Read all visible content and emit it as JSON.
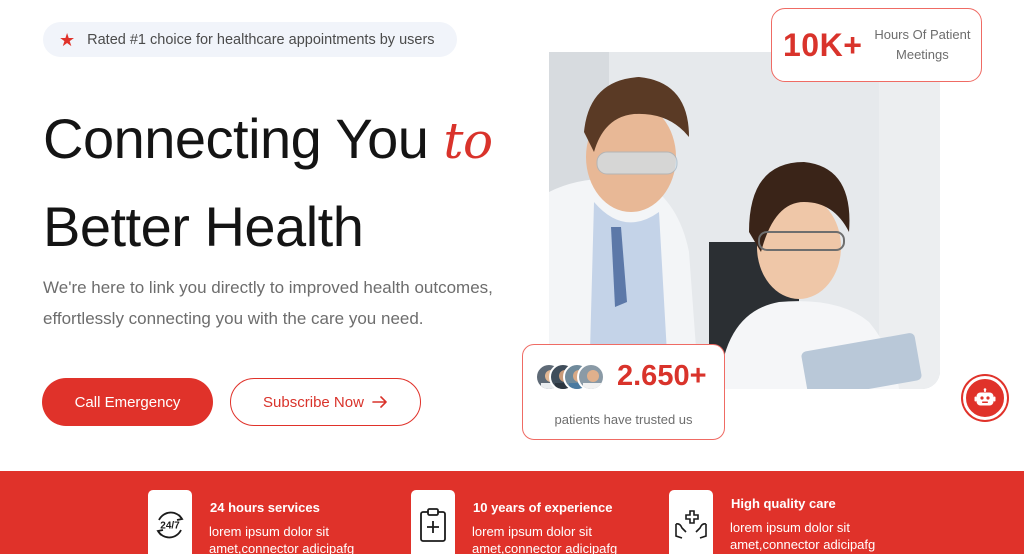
{
  "badge": {
    "text": "Rated #1 choice for healthcare appointments by users",
    "icon": "star-icon"
  },
  "hero": {
    "title_line1": "Connecting You",
    "title_accent": "to",
    "title_line2": "Better Health",
    "subtitle_line1": "We're here to link you directly to improved health outcomes,",
    "subtitle_line2": "effortlessly connecting you with the care you need."
  },
  "buttons": {
    "primary": "Call Emergency",
    "secondary": "Subscribe Now",
    "secondary_icon": "arrow-right-icon"
  },
  "stats": {
    "hours": {
      "value": "10K+",
      "label_line1": "Hours Of Patient",
      "label_line2": "Meetings"
    },
    "patients": {
      "value": "2.650+",
      "label": "patients have trusted us"
    }
  },
  "features": [
    {
      "title": "24 hours services",
      "text": "lorem ipsum dolor sit amet,connector adicipafg",
      "icon": "24-7-icon"
    },
    {
      "title": "10 years of experience",
      "text": "lorem ipsum dolor sit amet,connector adicipafg",
      "icon": "clipboard-plus-icon"
    },
    {
      "title": "High quality care",
      "text": "lorem ipsum dolor sit amet,connector adicipafg",
      "icon": "care-hands-icon"
    }
  ],
  "colors": {
    "accent": "#e0322a",
    "text": "#141414",
    "muted": "#6d6d6d",
    "badge_bg": "#f1f4fa"
  }
}
